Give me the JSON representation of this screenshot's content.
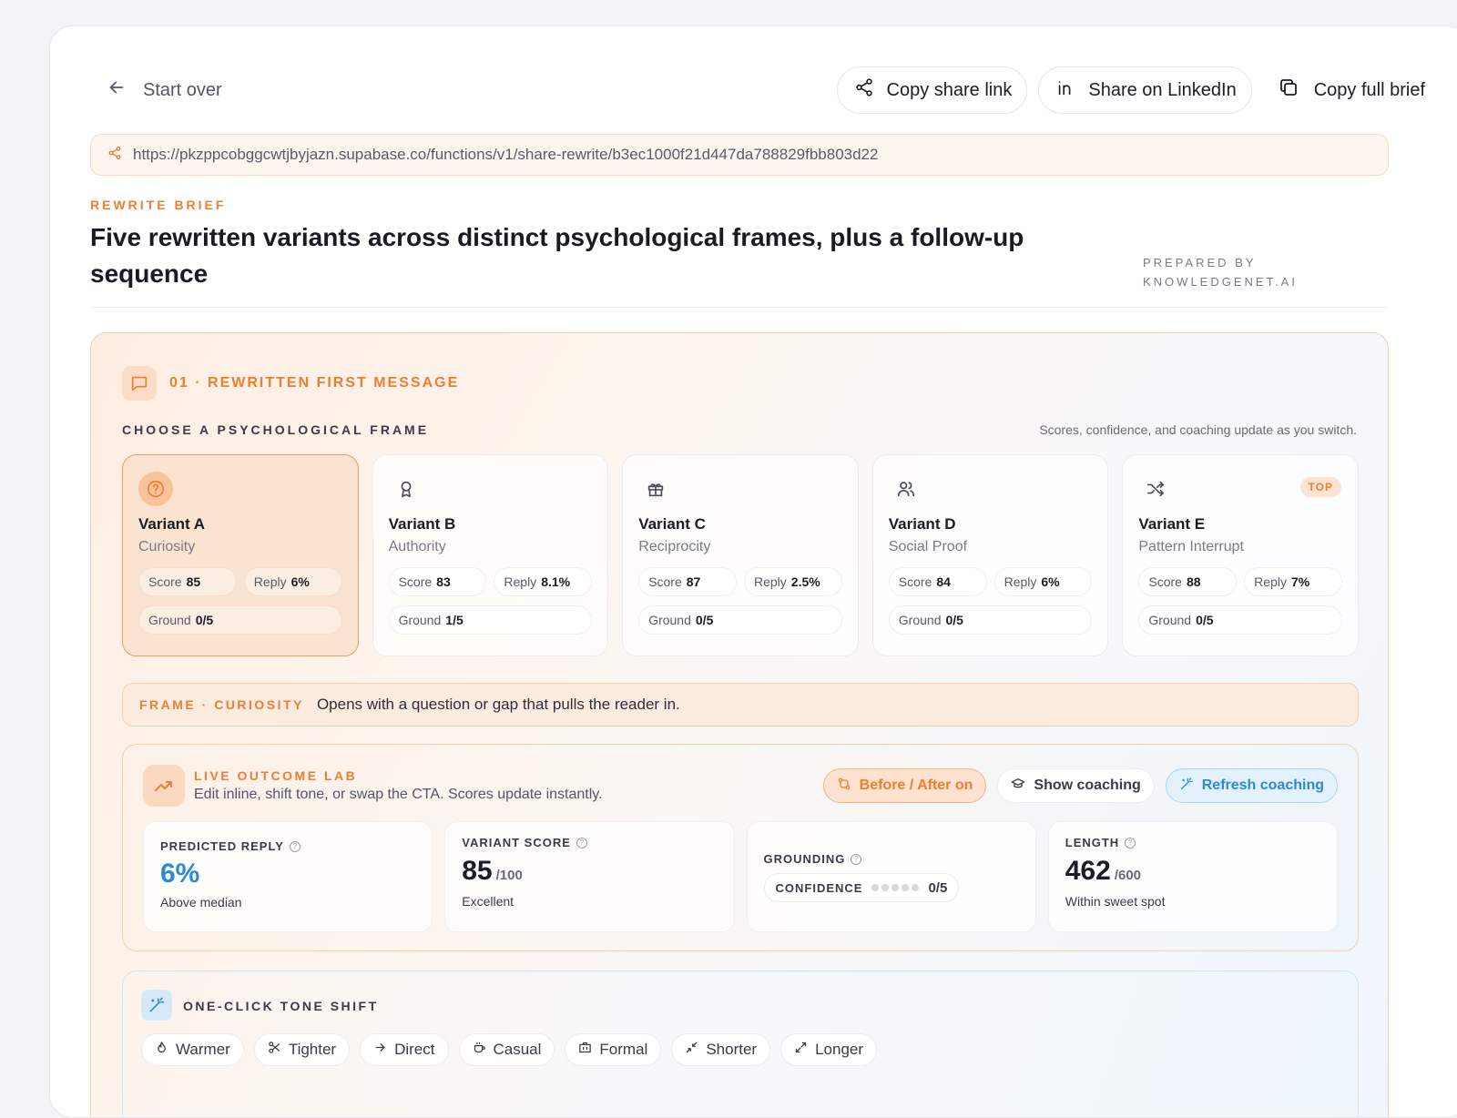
{
  "topbar": {
    "start_over": "Start over",
    "copy_share_link": "Copy share link",
    "share_linkedin": "Share on LinkedIn",
    "copy_full_brief": "Copy full brief"
  },
  "share_url": "https://pkzppcobggcwtjbyjazn.supabase.co/functions/v1/share-rewrite/b3ec1000f21d447da788829fbb803d22",
  "header": {
    "eyebrow": "REWRITE BRIEF",
    "title": "Five rewritten variants across distinct psychological frames, plus a follow-up sequence",
    "prepared_by": "PREPARED BY",
    "prepared_org": "KNOWLEDGENET.AI"
  },
  "section": {
    "title": "01 · REWRITTEN FIRST MESSAGE",
    "choose_label": "CHOOSE A PSYCHOLOGICAL FRAME",
    "choose_note": "Scores, confidence, and coaching update as you switch."
  },
  "labels": {
    "score": "Score",
    "reply": "Reply",
    "ground": "Ground"
  },
  "variants": [
    {
      "name": "Variant A",
      "frame": "Curiosity",
      "score": "85",
      "reply": "6%",
      "ground": "0/5",
      "icon": "question-circle-icon",
      "active": true,
      "badge": ""
    },
    {
      "name": "Variant B",
      "frame": "Authority",
      "score": "83",
      "reply": "8.1%",
      "ground": "1/5",
      "icon": "award-icon",
      "active": false,
      "badge": ""
    },
    {
      "name": "Variant C",
      "frame": "Reciprocity",
      "score": "87",
      "reply": "2.5%",
      "ground": "0/5",
      "icon": "gift-icon",
      "active": false,
      "badge": ""
    },
    {
      "name": "Variant D",
      "frame": "Social Proof",
      "score": "84",
      "reply": "6%",
      "ground": "0/5",
      "icon": "users-icon",
      "active": false,
      "badge": ""
    },
    {
      "name": "Variant E",
      "frame": "Pattern Interrupt",
      "score": "88",
      "reply": "7%",
      "ground": "0/5",
      "icon": "shuffle-icon",
      "active": false,
      "badge": "TOP"
    }
  ],
  "frame_bar": {
    "label": "FRAME · CURIOSITY",
    "description": "Opens with a question or gap that pulls the reader in."
  },
  "lab": {
    "title": "LIVE OUTCOME LAB",
    "subtitle": "Edit inline, shift tone, or swap the CTA. Scores update instantly.",
    "before_after": "Before / After on",
    "show_coaching": "Show coaching",
    "refresh_coaching": "Refresh coaching",
    "metrics": {
      "predicted_reply": {
        "label": "PREDICTED REPLY",
        "value": "6%",
        "note": "Above median"
      },
      "variant_score": {
        "label": "VARIANT SCORE",
        "value": "85",
        "unit": "/100",
        "note": "Excellent"
      },
      "grounding": {
        "label": "GROUNDING",
        "confidence_label": "CONFIDENCE",
        "confidence_value": "0/5"
      },
      "length": {
        "label": "LENGTH",
        "value": "462",
        "unit": "/600",
        "note": "Within sweet spot"
      }
    }
  },
  "tone": {
    "title": "ONE-CLICK TONE SHIFT",
    "buttons": [
      "Warmer",
      "Tighter",
      "Direct",
      "Casual",
      "Formal",
      "Shorter",
      "Longer"
    ]
  },
  "colors": {
    "accent": "#ef7d32",
    "blue": "#2b8ad6",
    "active_card_bg": "#fbe3d1"
  }
}
